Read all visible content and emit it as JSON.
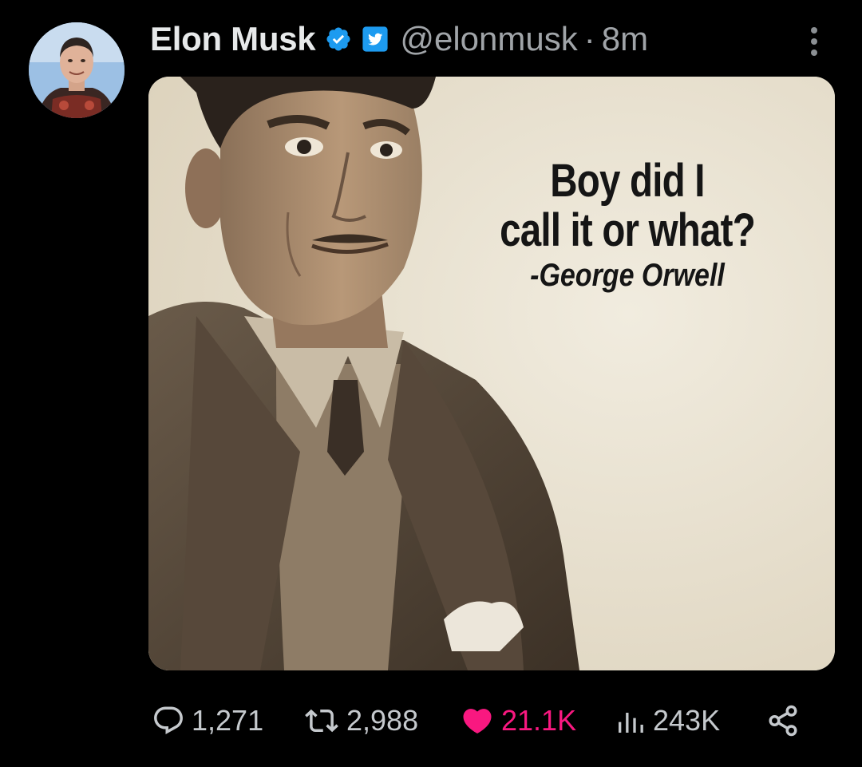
{
  "tweet": {
    "author": {
      "display_name": "Elon Musk",
      "handle": "@elonmusk",
      "avatar_icon": "avatar",
      "verified_icon": "verified-badge-icon",
      "badge_icon": "twitter-bird-badge-icon"
    },
    "separator": "·",
    "time_ago": "8m",
    "menu_icon": "more-vertical-icon",
    "media": {
      "caption_lines": [
        "Boy did I",
        "call it or what?"
      ],
      "attribution": "-George Orwell"
    },
    "actions": {
      "replies": {
        "icon": "reply-icon",
        "count": "1,271"
      },
      "retweets": {
        "icon": "retweet-icon",
        "count": "2,988"
      },
      "likes": {
        "icon": "heart-icon",
        "count": "21.1K",
        "liked": true
      },
      "views": {
        "icon": "views-chart-icon",
        "count": "243K"
      },
      "share": {
        "icon": "share-icon"
      }
    }
  },
  "colors": {
    "background": "#000000",
    "primary_text": "#e7e9ea",
    "secondary_text": "#a0a4a8",
    "verified_blue": "#1d9bf0",
    "like_pink": "#f91880"
  }
}
